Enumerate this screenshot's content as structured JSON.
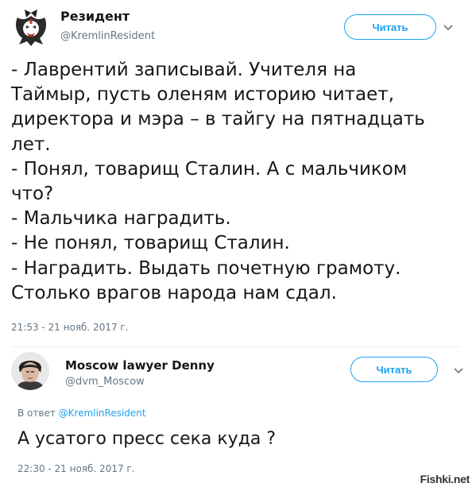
{
  "tweet1": {
    "name": "Резидент",
    "handle": "@KremlinResident",
    "follow_label": "Читать",
    "text": "- Лаврентий записывай. Учителя на\nТаймыр, пусть оленям историю читает,\nдиректора и мэра – в тайгу на пятнадцать\nлет.\n- Понял, товарищ Сталин. А с мальчиком\nчто?\n- Мальчика наградить.\n- Не понял, товарищ Сталин.\n- Наградить. Выдать почетную грамоту.\nСтолько врагов народа нам сдал.",
    "timestamp": "21:53 - 21 нояб. 2017 г."
  },
  "tweet2": {
    "name": "Moscow lawyer Denny",
    "handle": "@dvm_Moscow",
    "follow_label": "Читать",
    "reply_prefix": "В ответ",
    "reply_handle": "@KremlinResident",
    "text": "А усатого пресс сека куда ?",
    "timestamp": "22:30 - 21 нояб. 2017 г."
  },
  "watermark": "Fishki.net",
  "colors": {
    "accent": "#1da1f2",
    "muted": "#657786",
    "text": "#14171a"
  },
  "icons": {
    "caret": "chevron-down-icon"
  }
}
